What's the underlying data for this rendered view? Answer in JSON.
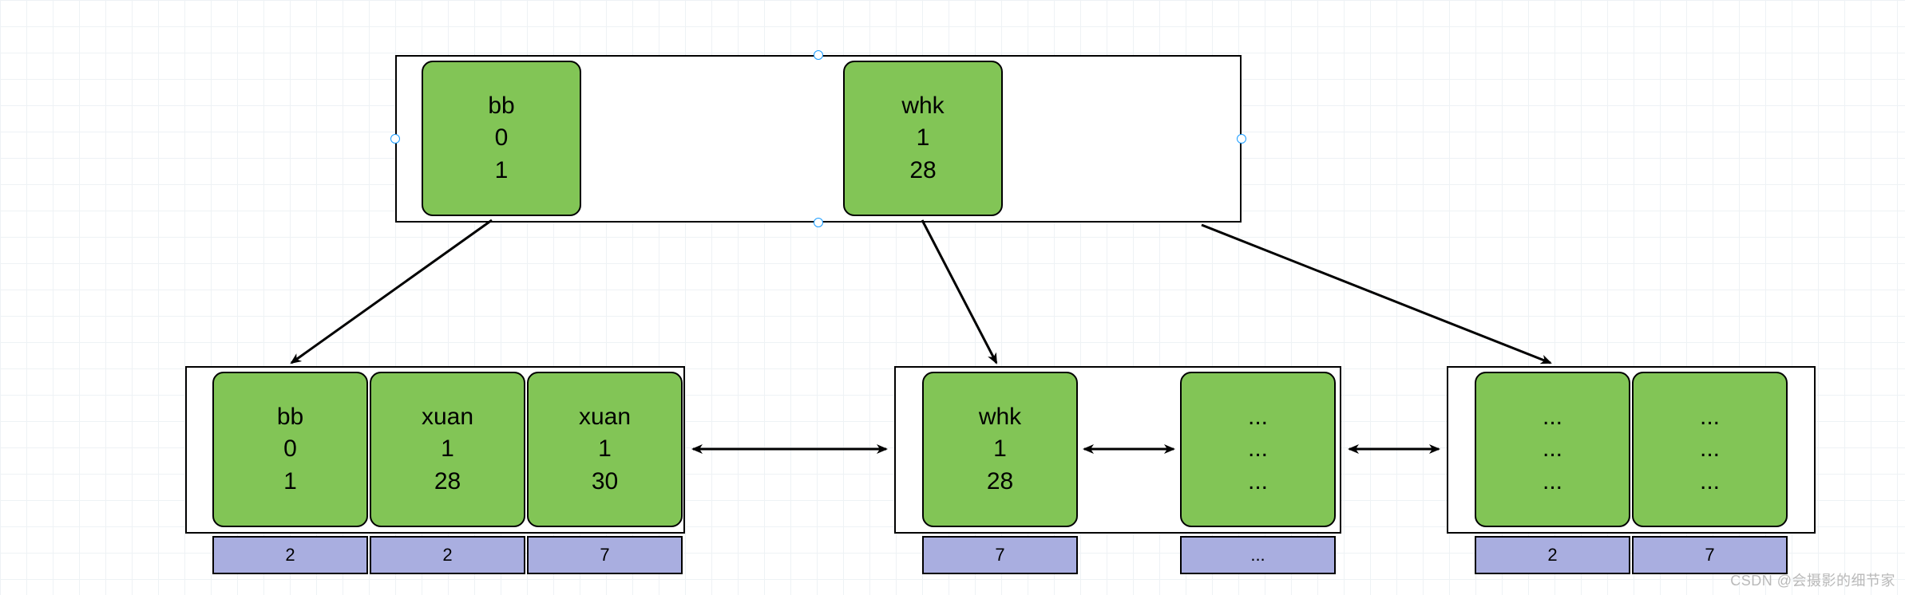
{
  "colors": {
    "node_fill": "#82c556",
    "tag_fill": "#a9aee0",
    "stroke": "#000000",
    "selection": "#1a9cff",
    "grid": "#eef2f5"
  },
  "top_container": {
    "nodes": [
      {
        "lines": [
          "bb",
          "0",
          "1"
        ]
      },
      {
        "lines": [
          "whk",
          "1",
          "28"
        ]
      }
    ]
  },
  "bottom_groups": [
    {
      "nodes": [
        {
          "lines": [
            "bb",
            "0",
            "1"
          ],
          "tag": "2"
        },
        {
          "lines": [
            "xuan",
            "1",
            "28"
          ],
          "tag": "2"
        },
        {
          "lines": [
            "xuan",
            "1",
            "30"
          ],
          "tag": "7"
        }
      ]
    },
    {
      "nodes": [
        {
          "lines": [
            "whk",
            "1",
            "28"
          ],
          "tag": "7"
        },
        {
          "lines": [
            "...",
            "...",
            "..."
          ],
          "tag": "..."
        }
      ]
    },
    {
      "nodes": [
        {
          "lines": [
            "...",
            "...",
            "..."
          ],
          "tag": "2"
        },
        {
          "lines": [
            "...",
            "...",
            "..."
          ],
          "tag": "7"
        }
      ]
    }
  ],
  "watermark": "CSDN @会摄影的细节家"
}
